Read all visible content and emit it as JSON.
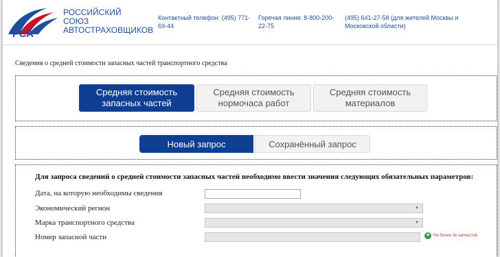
{
  "header": {
    "org_line1": "Российский",
    "org_line2": "Союз",
    "org_line3": "Автостраховщиков",
    "logo_text": "РСА",
    "contact_phone": "Контактный телефон: (495) 771-69-44",
    "hotline": "Горячая линия: 8-800-200-22-75",
    "moscow_phone": "(495) 641-27-58 (для жителей Москвы и Московской области)",
    "brand_color": "#1f4e9c",
    "accent_color": "#c8102e"
  },
  "section_title": "Сведения о средней стоимости запасных частей транспортного средства",
  "category_tabs": [
    {
      "label": "Средняя стоимость запасных частей",
      "active": true
    },
    {
      "label": "Средняя стоимость нормочаса работ",
      "active": false
    },
    {
      "label": "Средняя стоимость материалов",
      "active": false
    }
  ],
  "request_tabs": [
    {
      "label": "Новый запрос",
      "active": true
    },
    {
      "label": "Сохранённый запрос",
      "active": false
    }
  ],
  "form": {
    "heading": "Для запроса сведений о средней стоимости запасных частей необходимо ввести значения следующих обязательных параметров:",
    "date_label": "Дата, на которую необходимы сведения",
    "region_label": "Экономический регион",
    "brand_label": "Марка транспортного средства",
    "part_number_label": "Номер запасной части",
    "date_value": "",
    "region_value": "",
    "brand_value": "",
    "part_number_value": "",
    "limit_note": "Не более 3х запчастей",
    "add_icon": "plus-circle-icon"
  },
  "active_color": "#0f3f93"
}
